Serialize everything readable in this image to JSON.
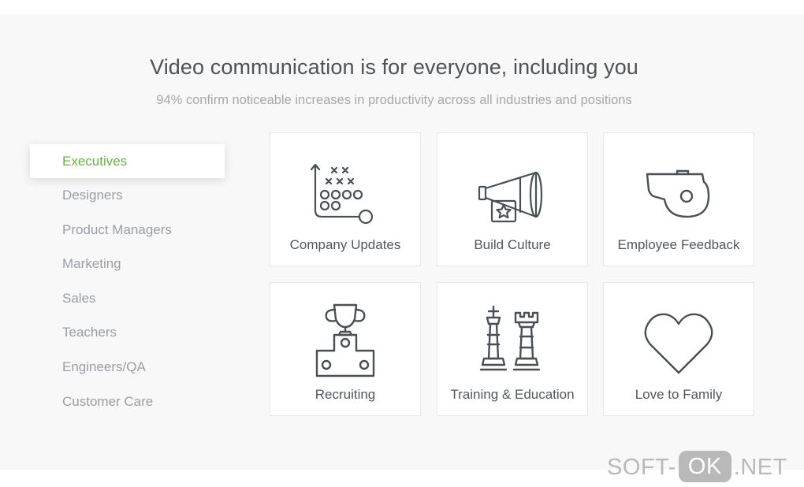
{
  "header": {
    "title": "Video communication is for everyone, including you",
    "subtitle": "94% confirm noticeable increases in productivity across all industries and positions"
  },
  "sidebar": {
    "items": [
      {
        "label": "Executives",
        "active": true
      },
      {
        "label": "Designers"
      },
      {
        "label": "Product Managers"
      },
      {
        "label": "Marketing"
      },
      {
        "label": "Sales"
      },
      {
        "label": "Teachers"
      },
      {
        "label": "Engineers/QA"
      },
      {
        "label": "Customer Care"
      }
    ]
  },
  "tiles": [
    {
      "label": "Company Updates",
      "icon": "strategy-play-icon"
    },
    {
      "label": "Build Culture",
      "icon": "megaphone-icon"
    },
    {
      "label": "Employee Feedback",
      "icon": "whistle-icon"
    },
    {
      "label": "Recruiting",
      "icon": "trophy-podium-icon"
    },
    {
      "label": "Training & Education",
      "icon": "chess-pieces-icon"
    },
    {
      "label": "Love to Family",
      "icon": "heart-icon"
    }
  ],
  "colors": {
    "accent": "#6cb33f",
    "text": "#52575c",
    "muted": "#9a9ea3",
    "icon_stroke": "#4a4f54"
  },
  "watermark": {
    "prefix": "SOFT-",
    "box": "OK",
    "suffix": ".NET"
  }
}
